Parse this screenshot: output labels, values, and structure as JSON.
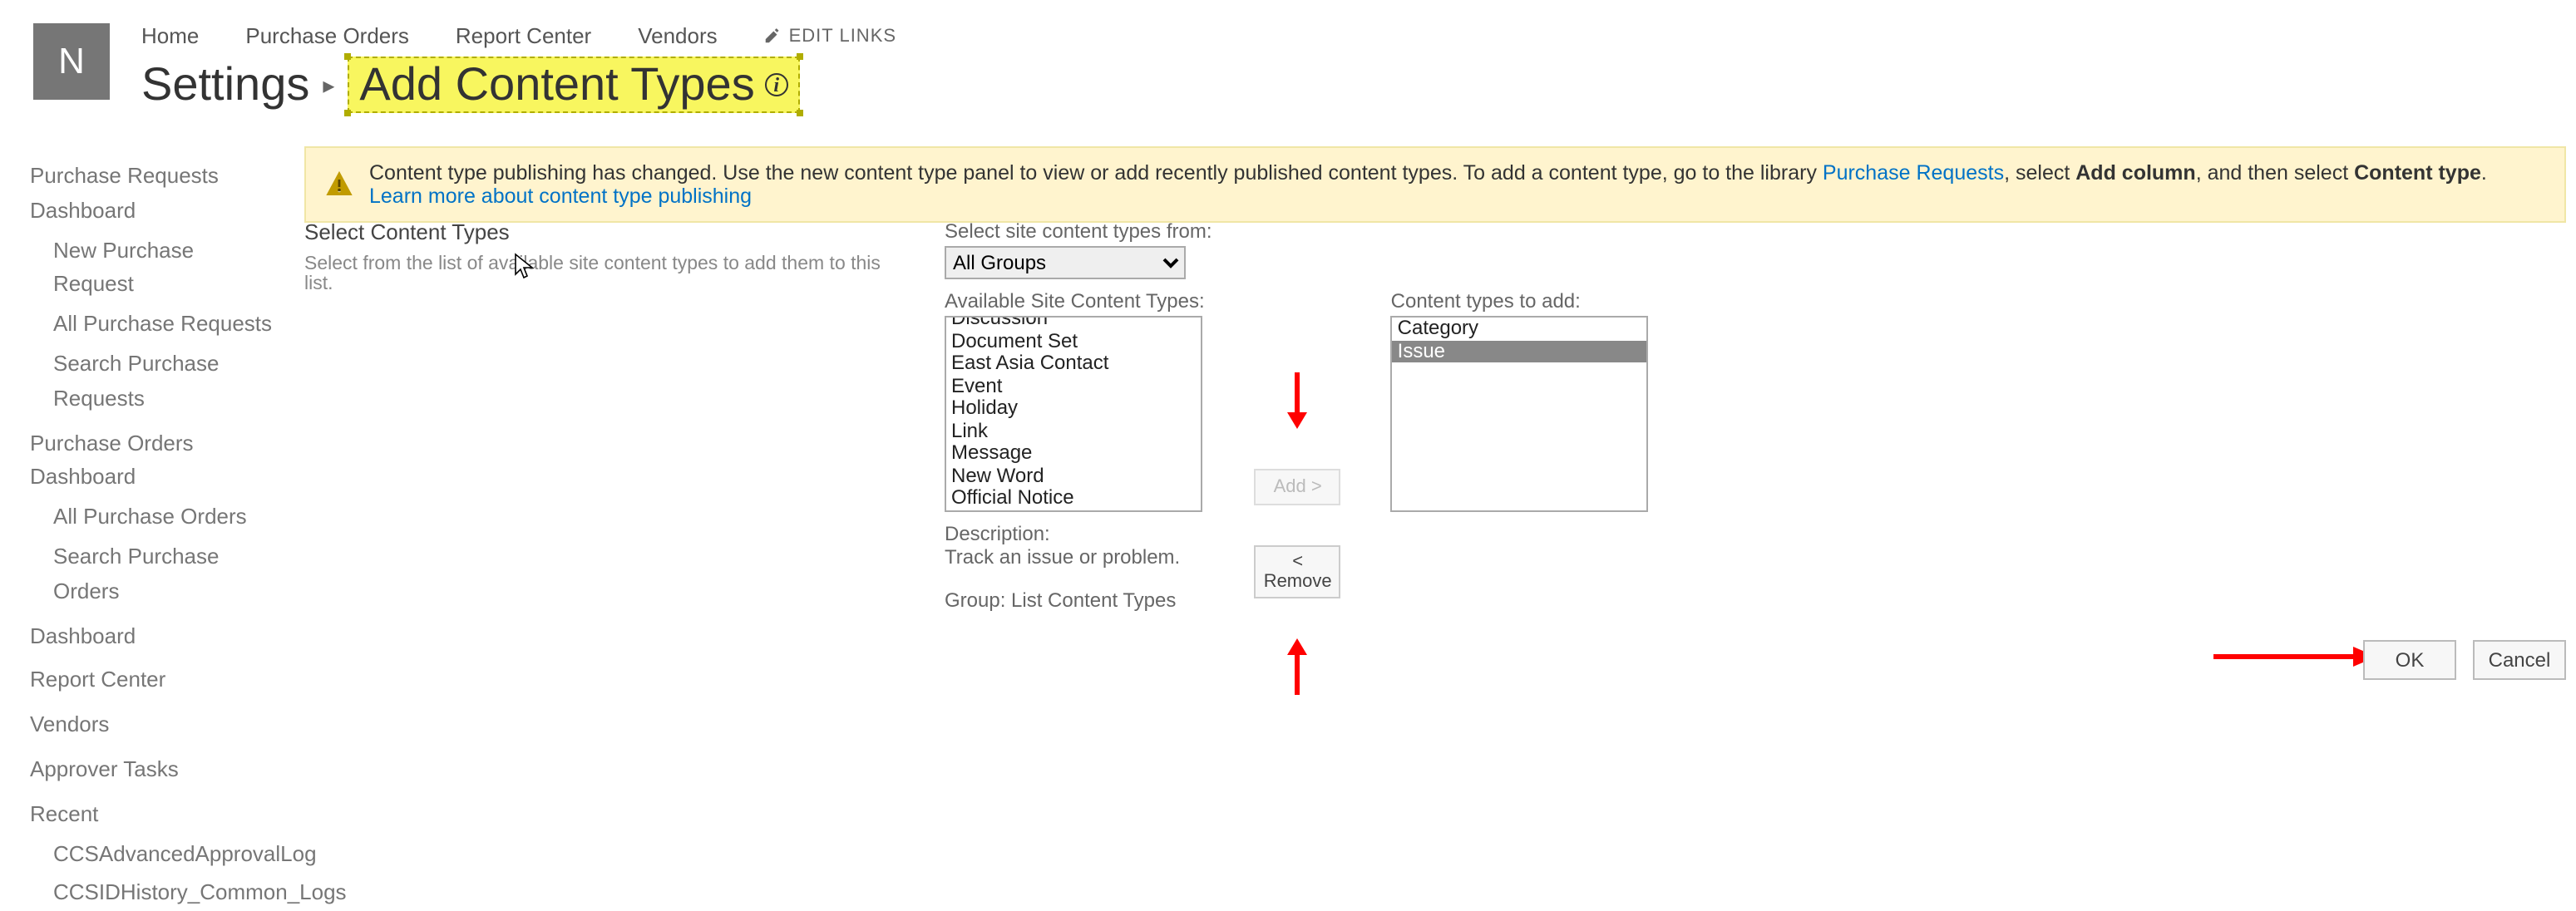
{
  "site_logo_letter": "N",
  "top_nav": {
    "home": "Home",
    "purchase_orders": "Purchase Orders",
    "report_center": "Report Center",
    "vendors": "Vendors",
    "edit_links": "EDIT LINKS"
  },
  "breadcrumb": {
    "settings": "Settings",
    "current": "Add Content Types"
  },
  "left_nav": {
    "purchase_requests_dash": "Purchase Requests Dashboard",
    "new_purchase_request": "New Purchase Request",
    "all_purchase_requests": "All Purchase Requests",
    "search_purchase_requests": "Search Purchase Requests",
    "purchase_orders_dash": "Purchase Orders Dashboard",
    "all_purchase_orders": "All Purchase Orders",
    "search_purchase_orders": "Search Purchase Orders",
    "dashboard": "Dashboard",
    "report_center": "Report Center",
    "vendors": "Vendors",
    "approver_tasks": "Approver Tasks",
    "recent": "Recent",
    "ccs_adv": "CCSAdvancedApprovalLog",
    "ccs_hist": "CCSIDHistory_Common_Logs"
  },
  "notice": {
    "prefix": "Content type publishing has changed. Use the new content type panel to view or add recently published content types. To add a content type, go to the library ",
    "link1": "Purchase Requests",
    "mid1": ", select ",
    "bold1": "Add column",
    "mid2": ", and then select ",
    "bold2": "Content type",
    "mid3": ". ",
    "link2": "Learn more about content type publishing"
  },
  "form": {
    "section_title": "Select Content Types",
    "section_desc": "Select from the list of available site content types to add them to this list.",
    "select_from_label": "Select site content types from:",
    "group_selected": "All Groups",
    "available_label": "Available Site Content Types:",
    "available_options": [
      "Discussion",
      "Document Set",
      "East Asia Contact",
      "Event",
      "Holiday",
      "Link",
      "Message",
      "New Word",
      "Official Notice"
    ],
    "add_btn": "Add >",
    "remove_btn_top": "<",
    "remove_btn_bot": "Remove",
    "toadd_label": "Content types to add:",
    "toadd_options": [
      "Category",
      "Issue"
    ],
    "toadd_selected": "Issue",
    "desc_label": "Description:",
    "desc_text": "Track an issue or problem.",
    "group_label": "Group: List Content Types"
  },
  "buttons": {
    "ok": "OK",
    "cancel": "Cancel"
  }
}
